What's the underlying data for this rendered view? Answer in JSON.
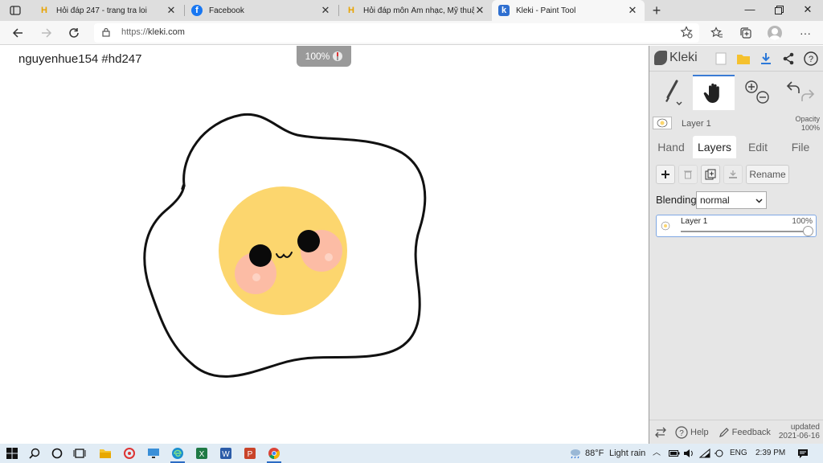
{
  "browser": {
    "tabs": [
      {
        "title": "Hỏi đáp 247 - trang tra loi",
        "favicon": "hoidap-247-icon",
        "active": false
      },
      {
        "title": "Facebook",
        "favicon": "facebook-icon",
        "active": false
      },
      {
        "title": "Hỏi đáp môn Âm nhạc, Mỹ thuật",
        "favicon": "hoidap-247-icon",
        "active": false
      },
      {
        "title": "Kleki - Paint Tool",
        "favicon": "kleki-icon",
        "active": true
      }
    ],
    "url_protocol": "https://",
    "url_host": "kleki.com"
  },
  "canvas": {
    "caption": "nguyenhue154 #hd247",
    "zoom": "100%"
  },
  "kleki": {
    "logo": "Kleki",
    "current_layer": {
      "name": "Layer 1",
      "opacity_label": "Opacity",
      "opacity_value": "100%"
    },
    "tabs": [
      "Hand",
      "Layers",
      "Edit",
      "File"
    ],
    "active_tab": "Layers",
    "rename_label": "Rename",
    "blending_label": "Blending",
    "blending_value": "normal",
    "layers": [
      {
        "name": "Layer 1",
        "opacity": "100%"
      }
    ],
    "footer": {
      "help": "Help",
      "feedback": "Feedback",
      "updated_label": "updated",
      "updated_date": "2021-06-16"
    }
  },
  "taskbar": {
    "weather_temp": "88°F",
    "weather_desc": "Light rain",
    "language": "ENG",
    "time": "2:39 PM"
  },
  "colors": {
    "yolk": "#fcd66e",
    "blush": "#fcbca5",
    "accent": "#3b7bd4"
  }
}
